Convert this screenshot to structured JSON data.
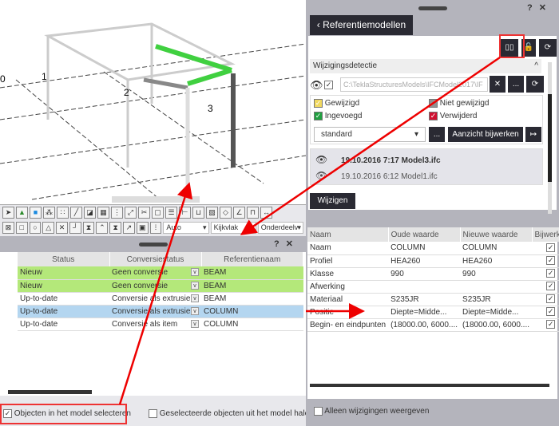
{
  "viewport": {
    "grid_labels": [
      "1",
      "2",
      "3",
      "0"
    ]
  },
  "toolbar": {
    "selects": [
      "Auto",
      "Kijkvlak",
      "Onderdeelv"
    ]
  },
  "left_panel": {
    "help": "?",
    "close": "✕",
    "columns": [
      "Status",
      "Conversiestatus",
      "Referentienaam"
    ],
    "rows": [
      {
        "status": "Nieuw",
        "conv": "Geen conversie",
        "ref": "BEAM",
        "style": "green"
      },
      {
        "status": "Nieuw",
        "conv": "Geen conversie",
        "ref": "BEAM",
        "style": "green"
      },
      {
        "status": "Up-to-date",
        "conv": "Conversie als extrusie",
        "ref": "BEAM",
        "style": ""
      },
      {
        "status": "Up-to-date",
        "conv": "Conversie als extrusie",
        "ref": "COLUMN",
        "style": "blue"
      },
      {
        "status": "Up-to-date",
        "conv": "Conversie als item",
        "ref": "COLUMN",
        "style": ""
      }
    ],
    "select_in_model": "Objecten in het model selecteren",
    "remove_selected": "Geselecteerde objecten uit het model halen"
  },
  "right_panel": {
    "help": "?",
    "close": "✕",
    "back_title": "Referentiemodellen",
    "section": "Wijzigingsdetectie",
    "path": "C:\\TeklaStructuresModels\\IFCModel2017\\IF",
    "legend": [
      "Gewijzigd",
      "Niet gewijzigd",
      "Ingevoegd",
      "Verwijderd"
    ],
    "legend_colors": [
      "#f0d860",
      "#909090",
      "#20a040",
      "#d01030"
    ],
    "filter": "standard",
    "more": "...",
    "update_view": "Aanzicht bijwerken",
    "models": [
      "19.10.2016 7:17 Model3.ifc",
      "19.10.2016 6:12 Model1.ifc"
    ],
    "change_button": "Wijzigen"
  },
  "props": {
    "columns": [
      "Naam",
      "Oude waarde",
      "Nieuwe waarde",
      "Bijwerken"
    ],
    "rows": [
      [
        "Naam",
        "COLUMN",
        "COLUMN"
      ],
      [
        "Profiel",
        "HEA260",
        "HEA260"
      ],
      [
        "Klasse",
        "990",
        "990"
      ],
      [
        "Afwerking",
        "",
        ""
      ],
      [
        "Materiaal",
        "S235JR",
        "S235JR"
      ],
      [
        "Positie",
        "Diepte=Midde...",
        "Diepte=Midde..."
      ],
      [
        "Begin- en eindpunten",
        "(18000.00, 6000....",
        "(18000.00, 6000...."
      ]
    ],
    "only_changes": "Alleen wijzigingen weergeven"
  }
}
